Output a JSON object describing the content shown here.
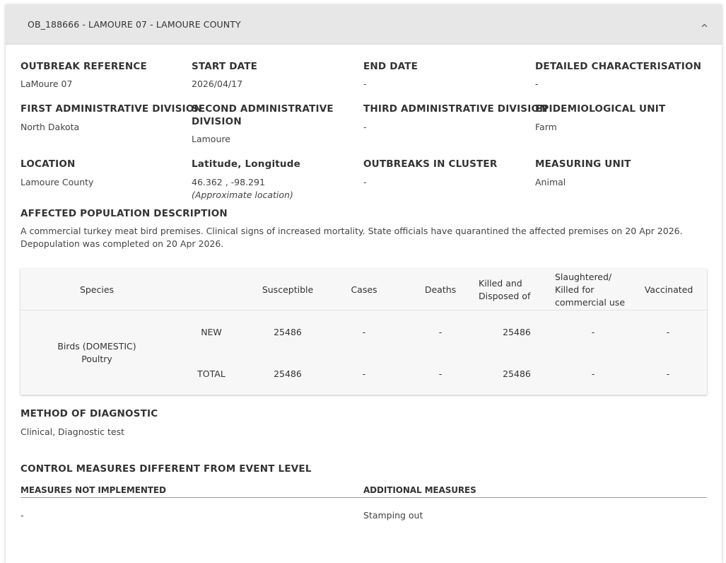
{
  "header": {
    "title": "OB_188666 - LAMOURE 07 - LAMOURE COUNTY"
  },
  "fields": {
    "outbreak_reference": {
      "label": "OUTBREAK REFERENCE",
      "value": "LaMoure 07"
    },
    "start_date": {
      "label": "START DATE",
      "value": "2026/04/17"
    },
    "end_date": {
      "label": "END DATE",
      "value": "-"
    },
    "detailed_characterisation": {
      "label": "DETAILED CHARACTERISATION",
      "value": "-"
    },
    "first_admin_division": {
      "label": "FIRST ADMINISTRATIVE DIVISION",
      "value": "North Dakota"
    },
    "second_admin_division": {
      "label_line1": "SECOND ADMINISTRATIVE",
      "label_line2": "DIVISION",
      "value": "Lamoure"
    },
    "third_admin_division": {
      "label": "THIRD ADMINISTRATIVE DIVISION",
      "value": "-"
    },
    "epidemiological_unit": {
      "label": "EPIDEMIOLOGICAL UNIT",
      "value": "Farm"
    },
    "location": {
      "label": "LOCATION",
      "value": "Lamoure County"
    },
    "lat_long": {
      "label": "Latitude, Longitude",
      "value": "46.362 , -98.291",
      "note": "(Approximate location)"
    },
    "outbreaks_in_cluster": {
      "label": "OUTBREAKS IN CLUSTER",
      "value": "-"
    },
    "measuring_unit": {
      "label": "MEASURING UNIT",
      "value": "Animal"
    }
  },
  "affected_population": {
    "label": "AFFECTED POPULATION DESCRIPTION",
    "line1": "A commercial turkey meat bird premises. Clinical signs of increased mortality. State officials have quarantined the affected premises on 20 Apr 2026.",
    "line2": "Depopulation was completed on 20 Apr 2026."
  },
  "table": {
    "headers": {
      "species": "Species",
      "susceptible": "Susceptible",
      "cases": "Cases",
      "deaths": "Deaths",
      "killed_line1": "Killed and",
      "killed_line2": "Disposed of",
      "slaughtered_line1": "Slaughtered/",
      "slaughtered_line2": "Killed for",
      "slaughtered_line3": "commercial use",
      "vaccinated": "Vaccinated"
    },
    "species_line1": "Birds (DOMESTIC)",
    "species_line2": "Poultry",
    "rows": [
      {
        "type": "NEW",
        "susceptible": "25486",
        "cases": "-",
        "deaths": "-",
        "killed": "25486",
        "slaughtered": "-",
        "vaccinated": "-"
      },
      {
        "type": "TOTAL",
        "susceptible": "25486",
        "cases": "-",
        "deaths": "-",
        "killed": "25486",
        "slaughtered": "-",
        "vaccinated": "-"
      }
    ]
  },
  "method_of_diagnostic": {
    "label": "METHOD OF DIAGNOSTIC",
    "value": "Clinical, Diagnostic test"
  },
  "control_measures": {
    "title": "CONTROL MEASURES DIFFERENT FROM EVENT LEVEL",
    "not_implemented_label": "MEASURES NOT IMPLEMENTED",
    "not_implemented_value": "-",
    "additional_label": "ADDITIONAL MEASURES",
    "additional_value": "Stamping out"
  }
}
